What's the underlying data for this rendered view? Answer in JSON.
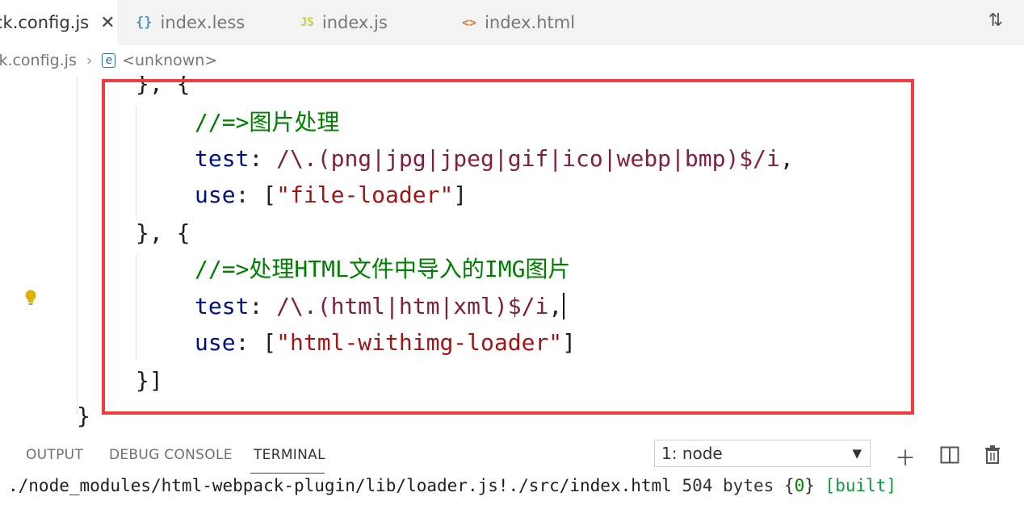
{
  "tabs": [
    {
      "label": "ck.config.js",
      "icon": "",
      "active": true
    },
    {
      "label": "index.less",
      "icon": "{}",
      "color": "#519aba"
    },
    {
      "label": "index.js",
      "icon": "JS",
      "color": "#cbcb41"
    },
    {
      "label": "index.html",
      "icon": "<>",
      "color": "#e37933"
    }
  ],
  "breadcrumb": {
    "file": "ck.config.js",
    "separator": "›",
    "symbol": "<unknown>"
  },
  "code": {
    "line1": "}, {",
    "line2_comment": "//=>图片处理",
    "line3_key": "test",
    "line3_regex": "/\\.(png|jpg|jpeg|gif|ico|webp|bmp)$/i",
    "line4_key": "use",
    "line4_value": "\"file-loader\"",
    "line5": "}, {",
    "line6_comment": "//=>处理HTML文件中导入的IMG图片",
    "line7_key": "test",
    "line7_regex": "/\\.(html|htm|xml)$/i",
    "line8_key": "use",
    "line8_value": "\"html-withimg-loader\"",
    "line9": "}]",
    "line10": "}"
  },
  "panel": {
    "tabs": [
      "OUTPUT",
      "DEBUG CONSOLE",
      "TERMINAL"
    ],
    "active_tab": "TERMINAL",
    "terminal_select": "1: node",
    "terminal_line": {
      "path": "./node_modules/html-webpack-plugin/lib/loader.js!./src/index.html",
      "size": "504 bytes",
      "chunk_open": "{",
      "chunk": "0",
      "chunk_close": "}",
      "status": "[built]"
    }
  },
  "colors": {
    "highlight_box": "#f03c3c",
    "comment": "#008000",
    "string": "#a31515",
    "keyword": "#001080"
  }
}
